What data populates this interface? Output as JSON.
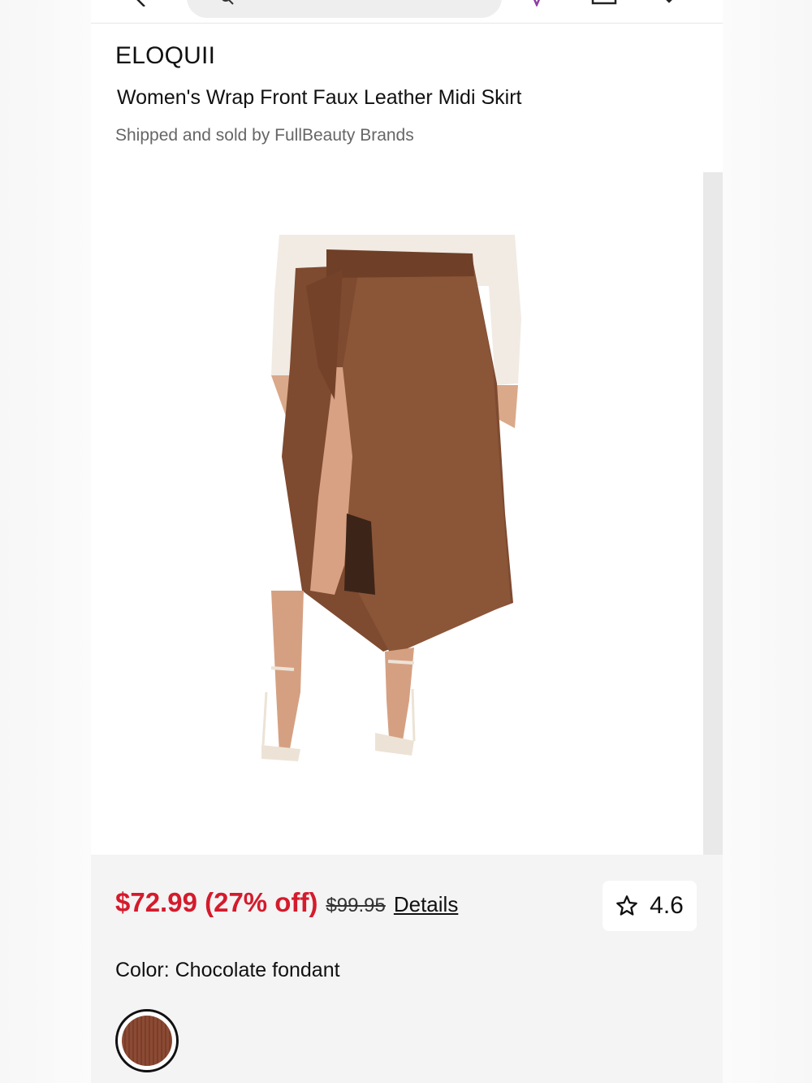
{
  "product": {
    "brand": "ELOQUII",
    "title": "Women's Wrap Front Faux Leather Midi Skirt",
    "seller": "Shipped and sold by FullBeauty Brands"
  },
  "pricing": {
    "sale_price": "$72.99 (27% off)",
    "original_price": "$99.95",
    "details_label": "Details"
  },
  "rating": {
    "value": "4.6",
    "icon": "star-icon"
  },
  "color": {
    "label": "Color: Chocolate fondant",
    "swatch_color": "#8b4a33"
  },
  "icons": [
    "back-arrow-icon",
    "search-icon",
    "wishlist-icon",
    "bag-icon",
    "cart-icon"
  ],
  "colors": {
    "sale_red": "#d41b2c",
    "skirt_brown": "#8a5437"
  }
}
